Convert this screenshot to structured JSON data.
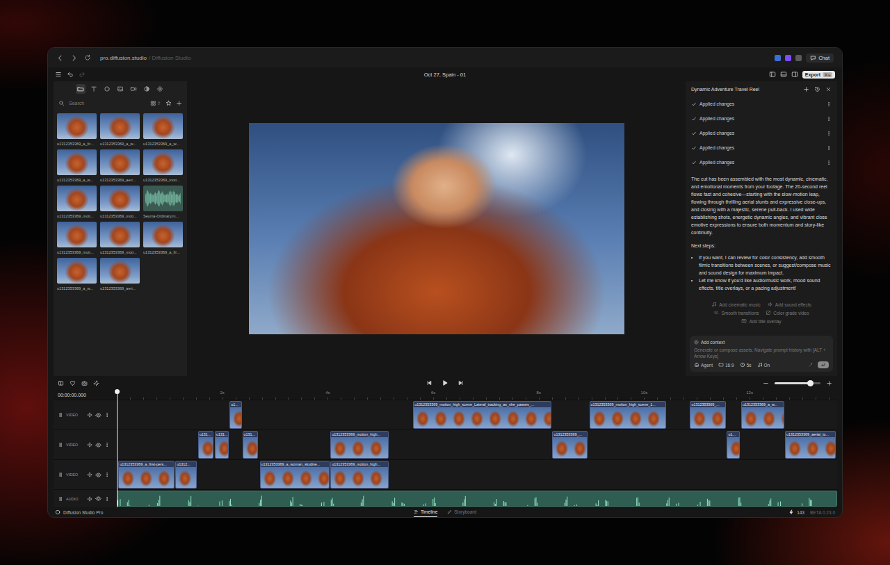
{
  "browser": {
    "url": "pro.diffusion.studio",
    "site": "/ Diffusion Studio",
    "chat": "Chat"
  },
  "header": {
    "title": "Oct 27, Spain - 01",
    "export": "Export",
    "shortcut": "⌘E"
  },
  "media": {
    "tools": [
      {
        "selected": true
      },
      {
        "selected": false
      },
      {
        "selected": false
      },
      {
        "selected": false
      },
      {
        "selected": false
      },
      {
        "selected": false
      },
      {
        "selected": false
      }
    ],
    "search": {
      "placeholder": "Search"
    },
    "items": [
      {
        "label": "u1312353369_a_fir...",
        "kind": "video"
      },
      {
        "label": "u1312353369_a_w...",
        "kind": "video"
      },
      {
        "label": "u1312353369_a_w...",
        "kind": "video"
      },
      {
        "label": "u1312353369_a_w...",
        "kind": "video"
      },
      {
        "label": "u1312353369_aeri...",
        "kind": "video"
      },
      {
        "label": "u1312353369_moti...",
        "kind": "video"
      },
      {
        "label": "u1312353369_moti...",
        "kind": "video"
      },
      {
        "label": "u1312353369_moti...",
        "kind": "video"
      },
      {
        "label": "Seyma-Ordinary.m...",
        "kind": "audio"
      },
      {
        "label": "u1312353369_moti...",
        "kind": "video"
      },
      {
        "label": "u1312353369_moti...",
        "kind": "video"
      },
      {
        "label": "u1312353369_a_fir...",
        "kind": "video"
      },
      {
        "label": "u1312353369_a_w...",
        "kind": "video"
      },
      {
        "label": "u1312353369_aeri...",
        "kind": "video"
      }
    ]
  },
  "chat": {
    "title": "Dynamic Adventure Travel Reel",
    "history": [
      {
        "label": "Applied changes",
        "done": true
      },
      {
        "label": "Applied changes",
        "done": true
      },
      {
        "label": "Applied changes",
        "done": true
      },
      {
        "label": "Applied changes",
        "done": true
      },
      {
        "label": "Applied changes",
        "done": true
      }
    ],
    "message": "The cut has been assembled with the most dynamic, cinematic, and emotional moments from your footage. The 20-second reel flows fast and cohesive—starting with the slow-motion leap, flowing through thrilling aerial stunts and expressive close-ups, and closing with a majestic, serene pull-back. I used wide establishing shots, energetic dynamic angles, and vibrant close emotive expressions to ensure both momentum and story-like continuity.",
    "next_steps": "Next steps:",
    "bullets": [
      "If you want, I can review for color consistency, add smooth filmic transitions between scenes, or suggest/compose music and sound design for maximum impact.",
      "Let me know if you'd like audio/music work, mood sound effects, title overlays, or a pacing adjustment!"
    ],
    "suggestions": [
      "Add cinematic music",
      "Add sound effects",
      "Smooth transitions",
      "Color grade video",
      "Add title overlay"
    ],
    "input": {
      "context": "Add context",
      "placeholder": "Generate or compose assets. Navigate prompt history with [ALT + Arrow Keys]"
    },
    "options": [
      "Agent",
      "16:9",
      "5s",
      "On"
    ]
  },
  "transport": {
    "time": "00:00:00.000",
    "zoom": {
      "level": 0.78
    }
  },
  "ruler": {
    "ticks": [
      {
        "label": "2s",
        "at": 2
      },
      {
        "label": "4s",
        "at": 4
      },
      {
        "label": "6s",
        "at": 6
      },
      {
        "label": "8s",
        "at": 8
      },
      {
        "label": "10s",
        "at": 10
      },
      {
        "label": "12s",
        "at": 12
      }
    ]
  },
  "tracks": [
    {
      "label": "VIDEO",
      "kind": "video",
      "visible": true,
      "clips": [
        {
          "label": "u1...",
          "start": 2.14,
          "end": 2.37
        },
        {
          "label": "u1312353369_motion_high_scene_Lateral_tracking_as_she_passes_...",
          "start": 5.62,
          "end": 8.24
        },
        {
          "label": "u1312353369_motion_high_scene_1...",
          "start": 8.96,
          "end": 10.41
        },
        {
          "label": "u1312353369_...",
          "start": 10.87,
          "end": 11.55
        },
        {
          "label": "u1312353369_a_w...",
          "start": 11.84,
          "end": 12.66
        }
      ]
    },
    {
      "label": "VIDEO",
      "kind": "video",
      "visible": true,
      "clips": [
        {
          "label": "u131...",
          "start": 1.54,
          "end": 1.83
        },
        {
          "label": "u131...",
          "start": 1.86,
          "end": 2.12
        },
        {
          "label": "u131...",
          "start": 2.38,
          "end": 2.68
        },
        {
          "label": "u1312353369_motion_high...",
          "start": 4.05,
          "end": 5.16
        },
        {
          "label": "u1312353369_...",
          "start": 8.26,
          "end": 8.93
        },
        {
          "label": "u1...",
          "start": 11.57,
          "end": 11.82
        },
        {
          "label": "u1312353369_aerial_to...",
          "start": 12.67,
          "end": 13.64
        }
      ]
    },
    {
      "label": "VIDEO",
      "kind": "video",
      "visible": true,
      "clips": [
        {
          "label": "u1312353369_a_first-pers...",
          "start": 0.03,
          "end": 1.09
        },
        {
          "label": "u1312...",
          "start": 1.11,
          "end": 1.51
        },
        {
          "label": "u1312353369_a_woman_skydive...",
          "start": 2.71,
          "end": 4.03
        },
        {
          "label": "u1312353369_motion_high...",
          "start": 4.05,
          "end": 5.16
        }
      ]
    },
    {
      "label": "AUDIO",
      "kind": "audio",
      "visible": true,
      "clips": [
        {
          "start": 0,
          "end": 13.66
        }
      ]
    }
  ],
  "status": {
    "app": "Diffusion Studio Pro",
    "tabs": [
      {
        "label": "Timeline",
        "selected": true
      },
      {
        "label": "Storyboard",
        "selected": false
      }
    ],
    "credits": "143",
    "version": "BETA 0.23.0"
  }
}
